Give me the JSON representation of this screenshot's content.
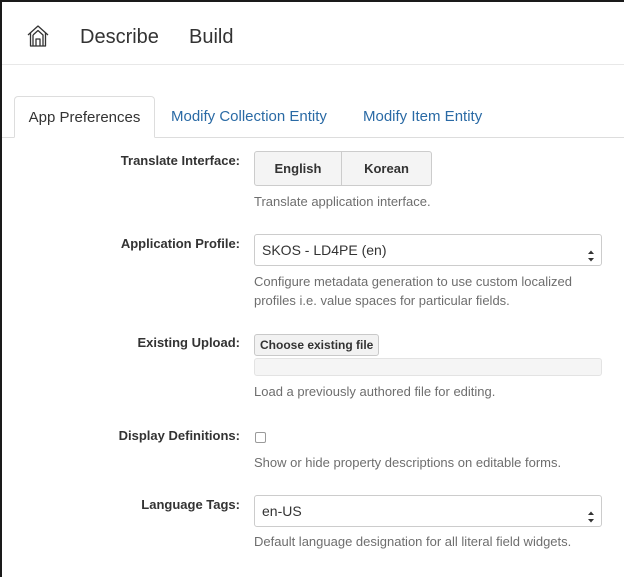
{
  "navbar": {
    "home_icon": "home-icon",
    "describe_label": "Describe",
    "build_label": "Build"
  },
  "tabs": [
    {
      "label": "App Preferences",
      "active": true
    },
    {
      "label": "Modify Collection Entity",
      "active": false
    },
    {
      "label": "Modify Item Entity",
      "active": false
    }
  ],
  "form": {
    "translate_interface": {
      "label": "Translate Interface:",
      "options": [
        "English",
        "Korean"
      ],
      "help": "Translate application interface."
    },
    "application_profile": {
      "label": "Application Profile:",
      "selected": "SKOS - LD4PE (en)",
      "help_line1": "Configure metadata generation to use custom localized",
      "help_line2": "profiles i.e. value spaces for particular fields."
    },
    "existing_upload": {
      "label": "Existing Upload:",
      "button_label": "Choose existing file",
      "path_value": "",
      "help": "Load a previously authored file for editing."
    },
    "display_definitions": {
      "label": "Display Definitions:",
      "checked": false,
      "help": "Show or hide property descriptions on editable forms."
    },
    "language_tags": {
      "label": "Language Tags:",
      "selected": "en-US",
      "help": "Default language designation for all literal field widgets."
    }
  },
  "colors": {
    "link": "#2a6aa5",
    "help_text": "#6e6e6e",
    "border": "#cccccc"
  }
}
